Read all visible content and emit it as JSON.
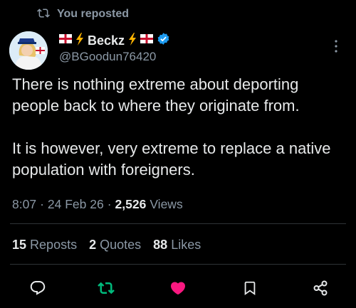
{
  "repost_banner": {
    "text": "You reposted",
    "icon": "repost-icon"
  },
  "author": {
    "display_name": "Beckz",
    "handle": "@BGoodun76420",
    "verified": true,
    "name_emojis": [
      "england-flag",
      "lightning"
    ],
    "name_emojis_after": [
      "lightning",
      "england-flag"
    ]
  },
  "post": {
    "paragraphs": [
      "There is nothing extreme about deporting people back to where they originate from.",
      "It is however, very extreme to replace a native population with foreigners."
    ],
    "time": "8:07",
    "date": "24 Feb 26",
    "sep": "·",
    "views_count": "2,526",
    "views_label": "Views"
  },
  "stats": {
    "reposts": {
      "count": "15",
      "label": "Reposts"
    },
    "quotes": {
      "count": "2",
      "label": "Quotes"
    },
    "likes": {
      "count": "88",
      "label": "Likes"
    }
  },
  "actions": [
    "reply-icon",
    "repost-icon",
    "like-icon",
    "bookmark-icon",
    "share-icon"
  ],
  "colors": {
    "background": "#000000",
    "text": "#e7e9ea",
    "muted": "#8b98a5",
    "repost_active": "#00ba7c",
    "like_active": "#f91880",
    "verified": "#1d9bf0",
    "divider": "#2f3336"
  }
}
